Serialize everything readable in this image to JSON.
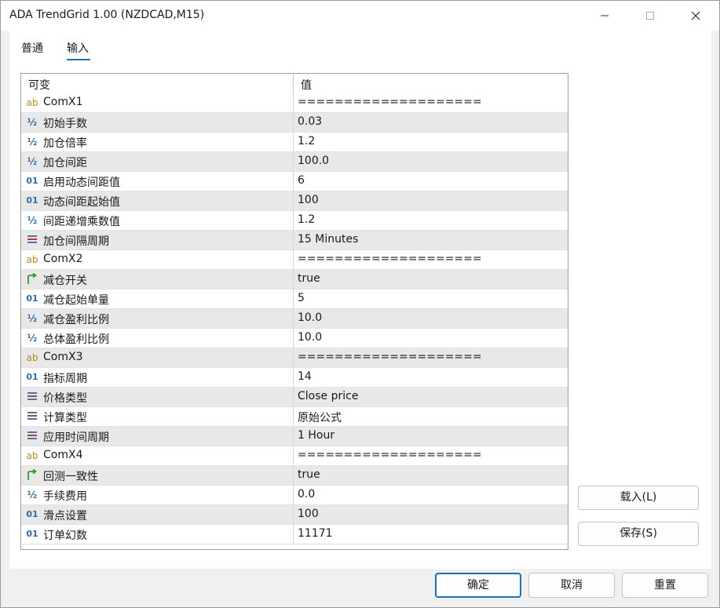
{
  "window": {
    "title": "ADA TrendGrid 1.00 (NZDCAD,M15)"
  },
  "tabs": [
    {
      "label": "普通"
    },
    {
      "label": "输入",
      "active": true
    }
  ],
  "grid": {
    "headers": {
      "variable": "可变",
      "value": "值"
    },
    "rows": [
      {
        "icon": "ab",
        "name": "ComX1",
        "value": "===================="
      },
      {
        "icon": "half",
        "name": "初始手数",
        "value": "0.03"
      },
      {
        "icon": "half",
        "name": "加仓倍率",
        "value": "1.2"
      },
      {
        "icon": "half",
        "name": "加仓间距",
        "value": "100.0"
      },
      {
        "icon": "bin",
        "name": "启用动态间距值",
        "value": "6"
      },
      {
        "icon": "bin",
        "name": "动态间距起始值",
        "value": "100"
      },
      {
        "icon": "half",
        "name": "间距递增乘数值",
        "value": "1.2"
      },
      {
        "icon": "enum",
        "name": "加仓间隔周期",
        "value": "15 Minutes"
      },
      {
        "icon": "ab",
        "name": "ComX2",
        "value": "===================="
      },
      {
        "icon": "bool",
        "name": "减仓开关",
        "value": "true"
      },
      {
        "icon": "bin",
        "name": "减仓起始单量",
        "value": "5"
      },
      {
        "icon": "half",
        "name": "减仓盈利比例",
        "value": "10.0"
      },
      {
        "icon": "half",
        "name": "总体盈利比例",
        "value": "10.0"
      },
      {
        "icon": "ab",
        "name": "ComX3",
        "value": "===================="
      },
      {
        "icon": "bin",
        "name": "指标周期",
        "value": "14"
      },
      {
        "icon": "enum",
        "name": "价格类型",
        "value": "Close price"
      },
      {
        "icon": "enum",
        "name": "计算类型",
        "value": "原始公式"
      },
      {
        "icon": "enum",
        "name": "应用时间周期",
        "value": "1 Hour"
      },
      {
        "icon": "ab",
        "name": "ComX4",
        "value": "===================="
      },
      {
        "icon": "bool",
        "name": "回测一致性",
        "value": "true"
      },
      {
        "icon": "half",
        "name": "手续费用",
        "value": "0.0"
      },
      {
        "icon": "bin",
        "name": "滑点设置",
        "value": "100"
      },
      {
        "icon": "bin",
        "name": "订单幻数",
        "value": "11171"
      }
    ]
  },
  "icons": {
    "ab": "ab",
    "half": "½",
    "bin": "01"
  },
  "buttons": {
    "load": "载入(L)",
    "save": "保存(S)",
    "ok": "确定",
    "cancel": "取消",
    "reset": "重置"
  },
  "colors": {
    "accent": "#1a6fb5",
    "alt_row": "#e8e8e8"
  }
}
